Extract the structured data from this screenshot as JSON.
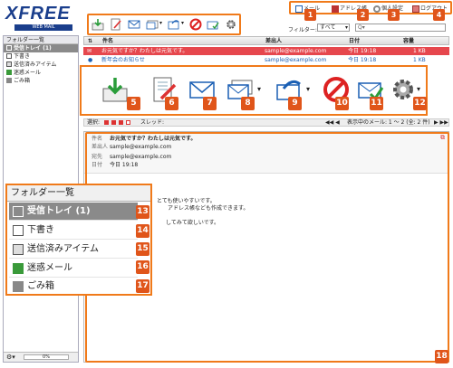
{
  "app": {
    "logo": "XFREE",
    "logo_sub": "WEB MAIL"
  },
  "top_links": [
    {
      "label": "メール",
      "icon": "mail-icon"
    },
    {
      "label": "アドレス帳",
      "icon": "address-book-icon"
    },
    {
      "label": "個人設定",
      "icon": "settings-icon"
    },
    {
      "label": "ログアウト",
      "icon": "logout-icon"
    }
  ],
  "badges": [
    "1",
    "2",
    "3",
    "4",
    "5",
    "6",
    "7",
    "8",
    "9",
    "10",
    "11",
    "12",
    "13",
    "14",
    "15",
    "16",
    "17",
    "18"
  ],
  "filter": {
    "label": "フィルター:",
    "value": "すべて",
    "search_placeholder": "Q▾"
  },
  "sidebar": {
    "title": "フォルダー一覧",
    "items": [
      {
        "label": "受信トレイ (1)",
        "icon": "inbox-icon",
        "selected": true
      },
      {
        "label": "下書き",
        "icon": "draft-icon"
      },
      {
        "label": "送信済みアイテム",
        "icon": "sent-icon"
      },
      {
        "label": "迷惑メール",
        "icon": "junk-icon"
      },
      {
        "label": "ごみ箱",
        "icon": "trash-icon"
      }
    ],
    "quota": "0%"
  },
  "list": {
    "columns": {
      "subject": "件名",
      "from": "差出人",
      "date": "日付",
      "size": "容量"
    },
    "rows": [
      {
        "subject": "お元気ですか？わたしは元気です。",
        "from": "sample@example.com",
        "date": "今日 19:18",
        "size": "1 KB",
        "state": "selected"
      },
      {
        "subject": "新年会のお知らせ",
        "from": "sample@example.com",
        "date": "今日 19:18",
        "size": "1 KB",
        "state": "unread"
      }
    ],
    "footer_select": "選択:",
    "footer_thread": "スレッド:",
    "footer_count": "表示中のメール: 1 ～ 2 (全: 2 件)"
  },
  "preview": {
    "subject_label": "件名",
    "subject": "お元気ですか？わたしは元気です。",
    "from_label": "差出人",
    "from": "sample@example.com",
    "to_label": "宛先",
    "to": "sample@example.com",
    "date_label": "日付",
    "date": "今日 19:18",
    "body_lines": [
      "とても使いやすいです。",
      "アドレス帳なども作成できます。",
      "してみて欲しいです。"
    ]
  },
  "folder_panel": {
    "title": "フォルダー一覧",
    "items": [
      {
        "label": "受信トレイ (1)",
        "icon": "inbox-icon",
        "selected": true
      },
      {
        "label": "下書き",
        "icon": "draft-icon"
      },
      {
        "label": "送信済みアイテム",
        "icon": "sent-icon"
      },
      {
        "label": "迷惑メール",
        "icon": "junk-icon"
      },
      {
        "label": "ごみ箱",
        "icon": "trash-icon"
      }
    ]
  },
  "colors": {
    "accent": "#f07a1a",
    "badge": "#e0551a",
    "brand": "#1a3e8c",
    "selected_row": "#e6474d",
    "unread": "#1a5fb4"
  }
}
